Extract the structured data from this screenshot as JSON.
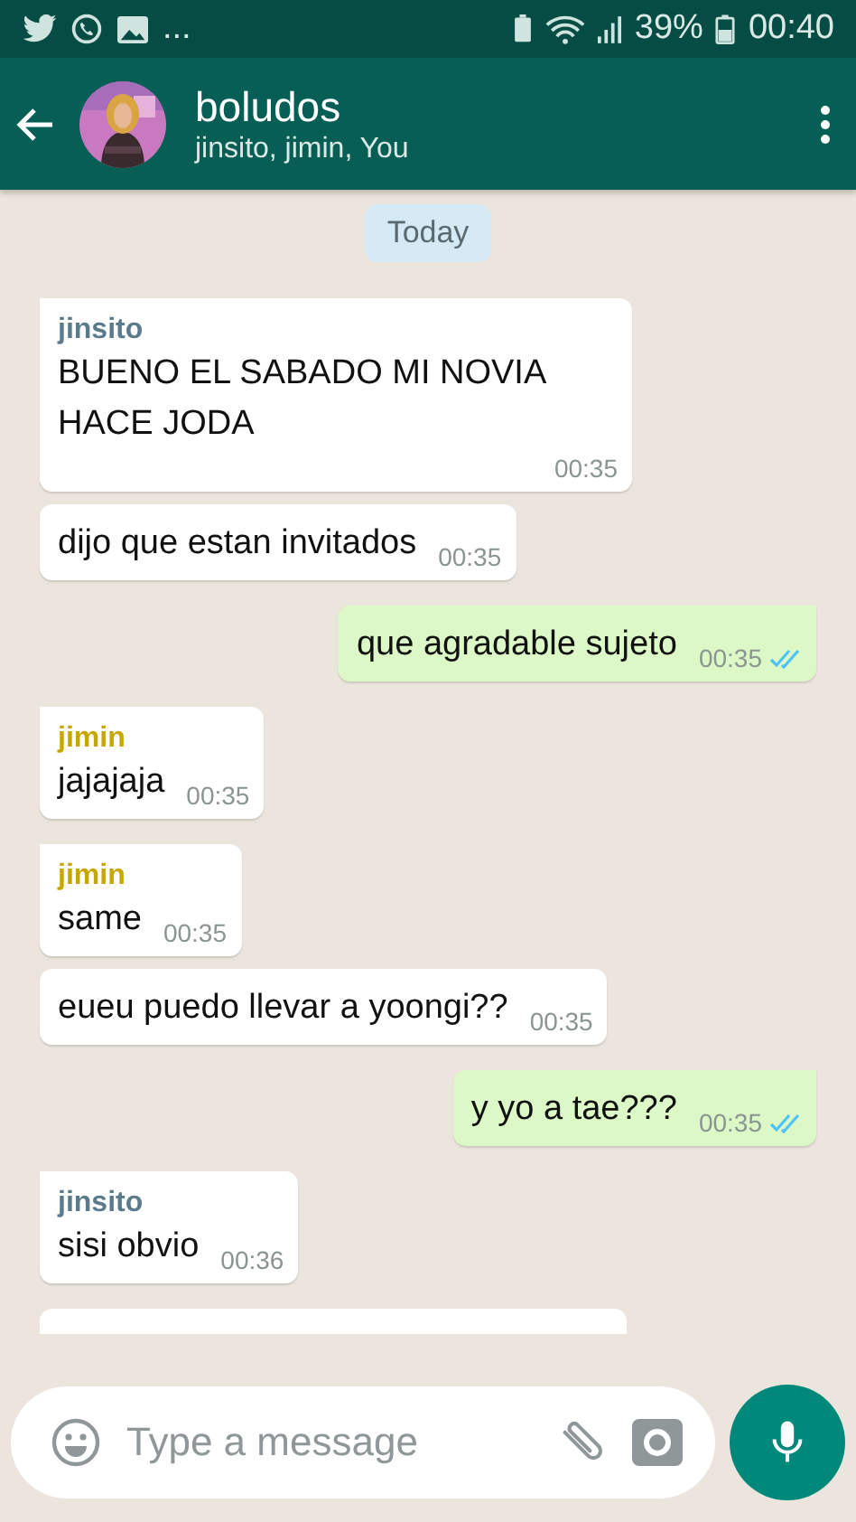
{
  "status_bar": {
    "notifications": "...",
    "battery": "39%",
    "time": "00:40"
  },
  "header": {
    "title": "boludos",
    "subtitle": "jinsito, jimin, You"
  },
  "date_chip": "Today",
  "messages": [
    {
      "kind": "incoming",
      "sender": "jinsito",
      "color": "#5b7b8c",
      "text": "BUENO EL SABADO MI NOVIA HACE JODA",
      "time": "00:35"
    },
    {
      "kind": "incoming",
      "text": "dijo que estan invitados",
      "time": "00:35"
    },
    {
      "kind": "outgoing",
      "text": "que agradable sujeto",
      "time": "00:35",
      "read": true
    },
    {
      "kind": "incoming",
      "sender": "jimin",
      "color": "#c7a600",
      "text": "jajajaja",
      "time": "00:35"
    },
    {
      "kind": "incoming",
      "sender": "jimin",
      "color": "#c7a600",
      "text": "same",
      "time": "00:35"
    },
    {
      "kind": "incoming",
      "text": "eueu puedo llevar a yoongi??",
      "time": "00:35"
    },
    {
      "kind": "outgoing",
      "text": "y yo a tae???",
      "time": "00:35",
      "read": true
    },
    {
      "kind": "incoming",
      "sender": "jinsito",
      "color": "#5b7b8c",
      "text": "sisi obvio",
      "time": "00:36"
    }
  ],
  "more_below": true,
  "composer": {
    "placeholder": "Type a message"
  }
}
